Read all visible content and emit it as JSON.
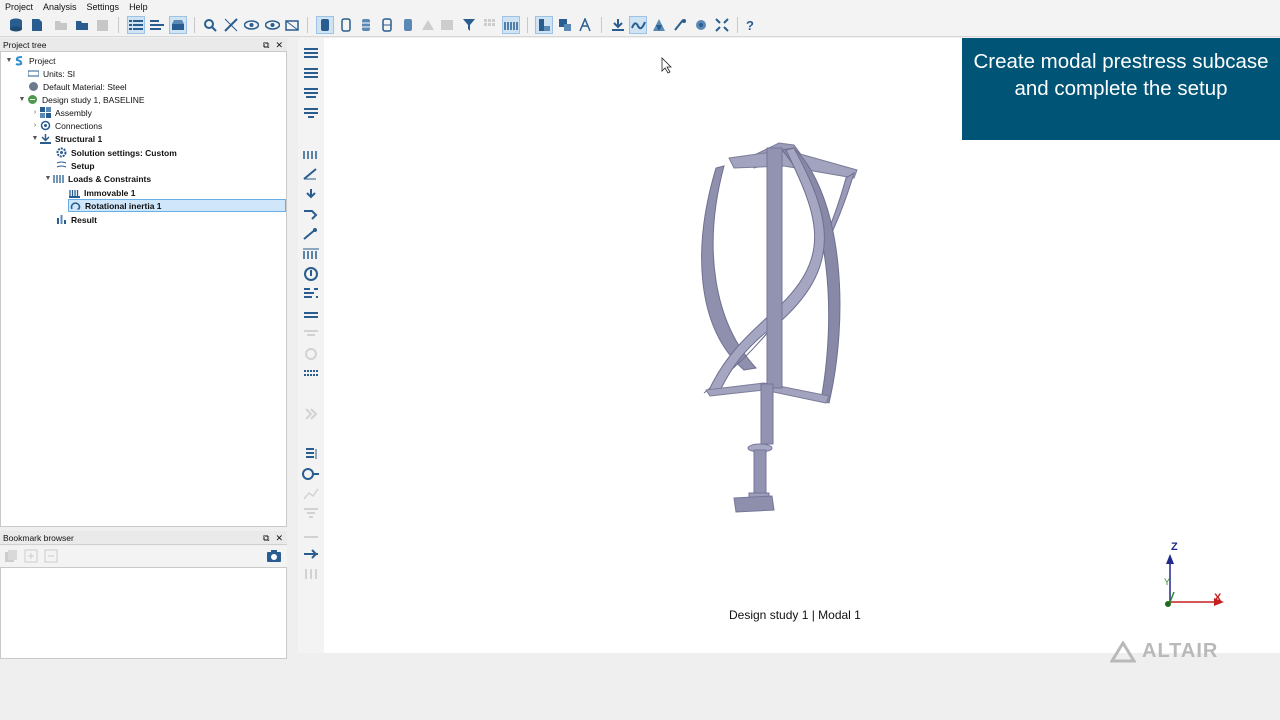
{
  "menu": [
    "Project",
    "Analysis",
    "Settings",
    "Help"
  ],
  "project_tree": {
    "title": "Project tree",
    "nodes": [
      {
        "label": "Project",
        "bold": false
      },
      {
        "label": "Units: SI",
        "bold": false
      },
      {
        "label": "Default Material: Steel",
        "bold": false
      },
      {
        "label": "Design study 1, BASELINE",
        "bold": false
      },
      {
        "label": "Assembly",
        "bold": false
      },
      {
        "label": "Connections",
        "bold": false
      },
      {
        "label": "Structural 1",
        "bold": true
      },
      {
        "label": "Solution settings: Custom",
        "bold": true
      },
      {
        "label": "Setup",
        "bold": true
      },
      {
        "label": "Loads & Constraints",
        "bold": true
      },
      {
        "label": "Immovable 1",
        "bold": true
      },
      {
        "label": "Rotational inertia 1",
        "bold": true,
        "selected": true
      },
      {
        "label": "Result",
        "bold": true
      }
    ]
  },
  "bookmark_browser": {
    "title": "Bookmark browser"
  },
  "callout": {
    "text": "Create modal prestress subcase and complete the setup"
  },
  "viewport": {
    "study_label": "Design study 1 | Modal 1"
  },
  "axes": {
    "z": "Z",
    "y": "Y",
    "x": "X"
  },
  "logo": {
    "text": "ALTAIR"
  },
  "colors": {
    "callout_bg": "#005475",
    "accent": "#2f6fa8",
    "model": "#8f90ad"
  }
}
